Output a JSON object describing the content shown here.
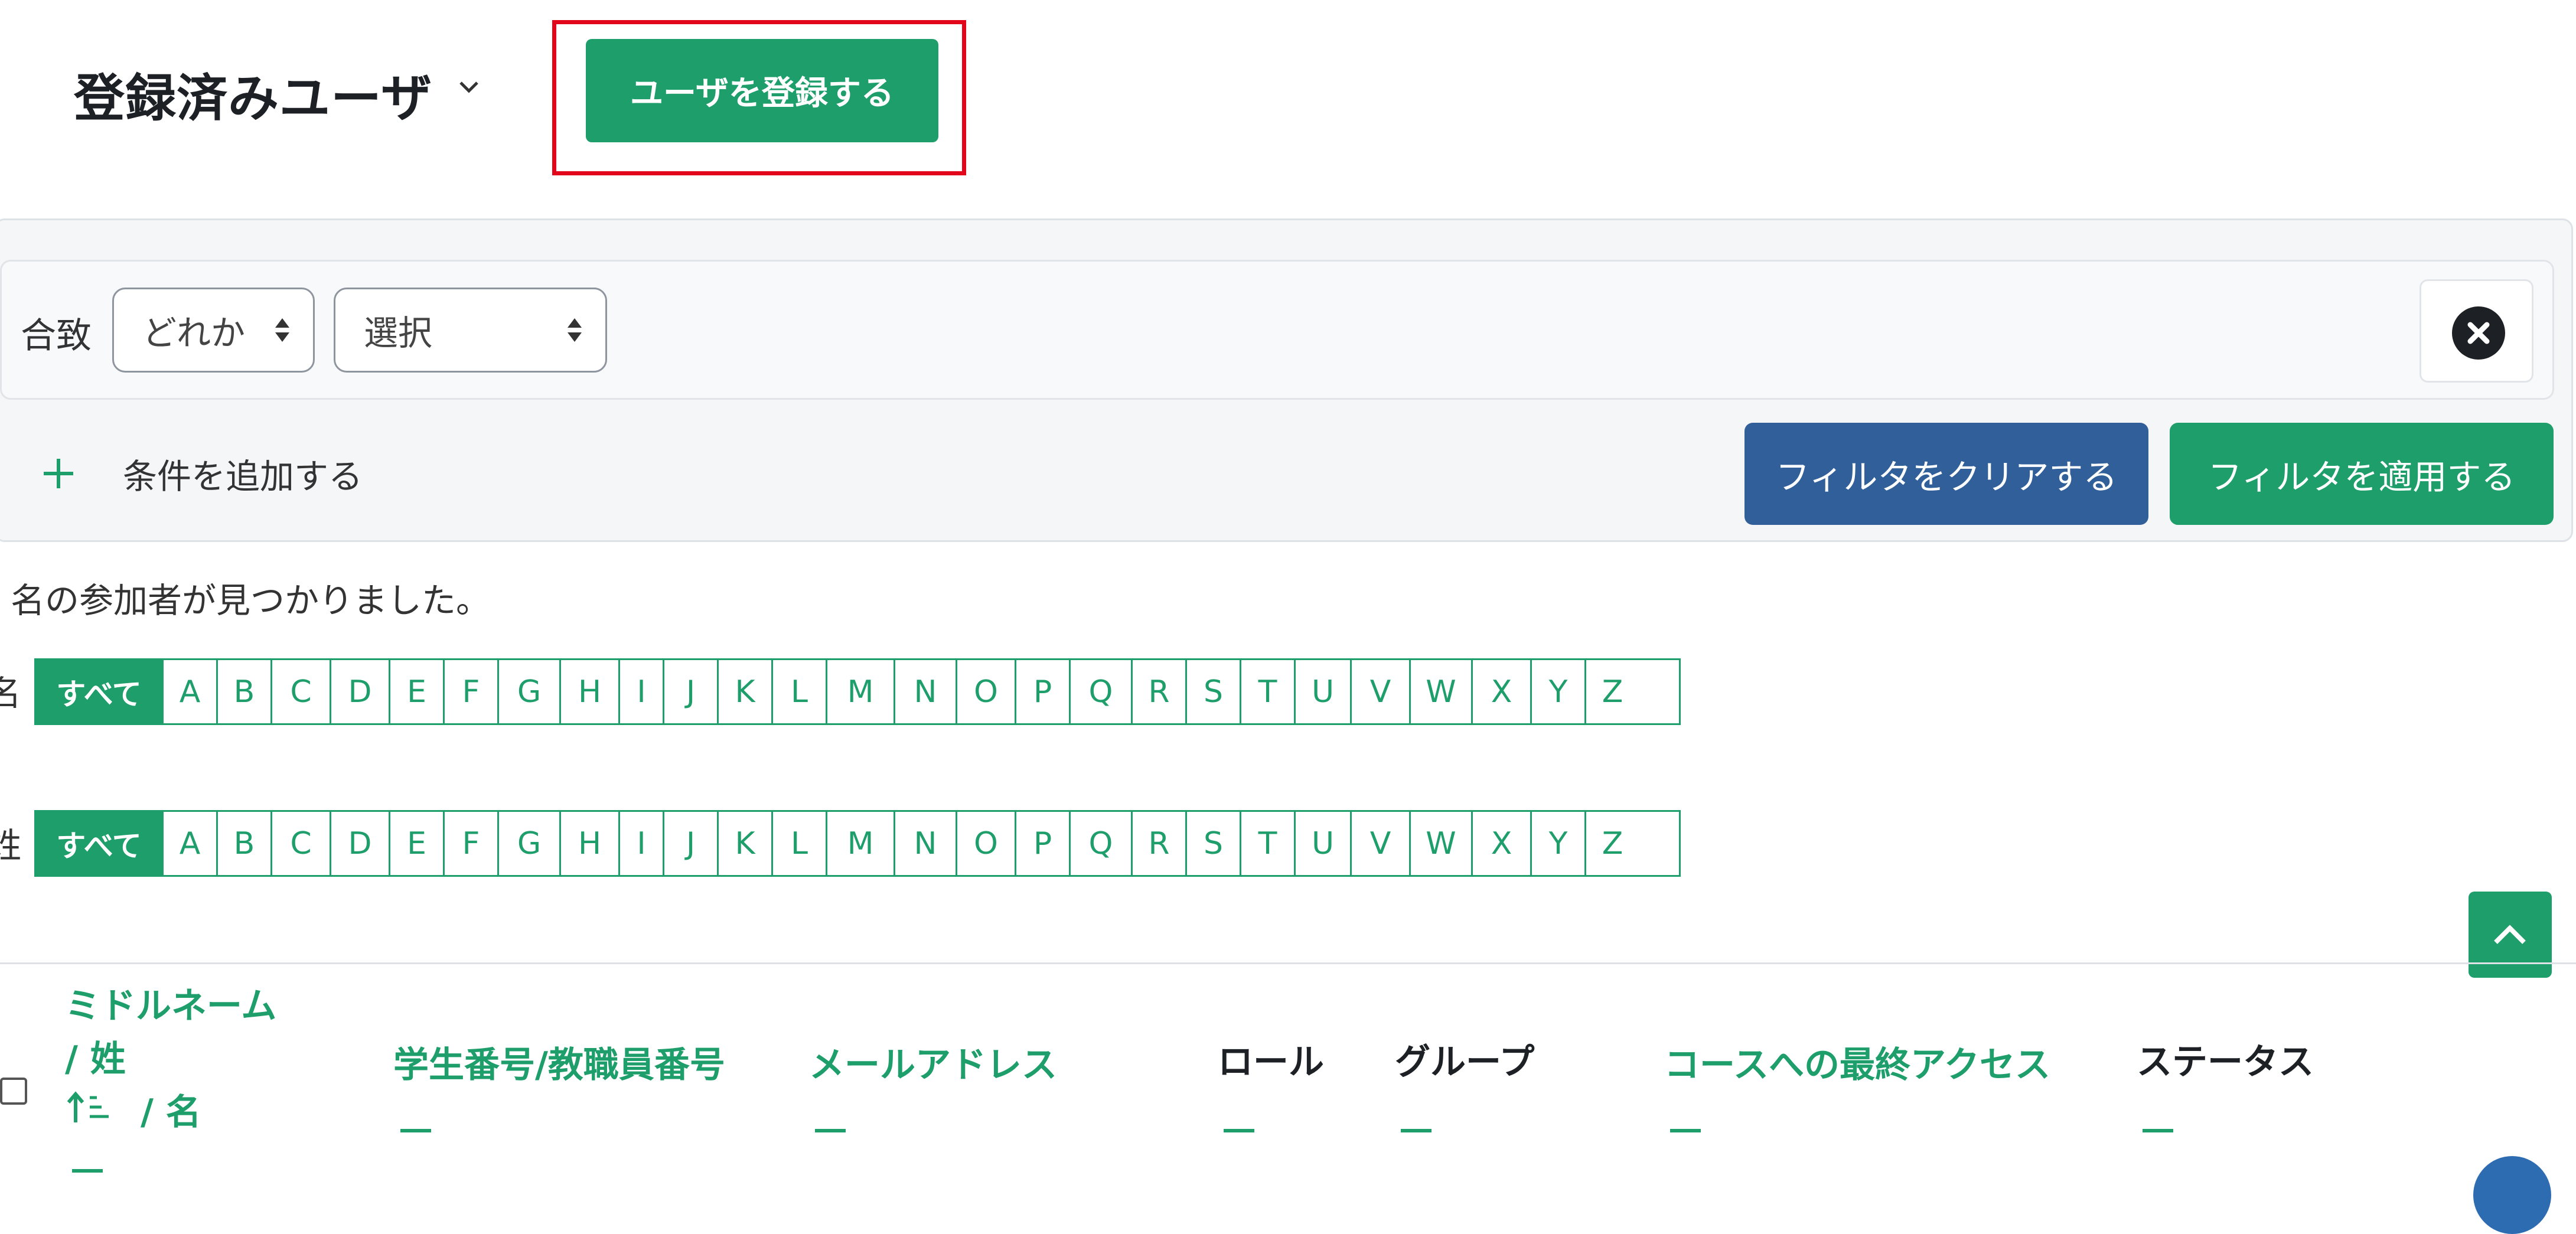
{
  "header": {
    "title": "登録済みユーザ",
    "enrol_button": "ユーザを登録する"
  },
  "filter": {
    "match_label": "合致",
    "match_select": "どれか",
    "type_select": "選択",
    "add_condition": "条件を追加する",
    "clear_button": "フィルタをクリアする",
    "apply_button": "フィルタを適用する"
  },
  "participants_count": "名の参加者が見つかりました。",
  "initials": {
    "first_label": "名",
    "last_label": "姓",
    "all_label": "すべて",
    "letters": [
      "A",
      "B",
      "C",
      "D",
      "E",
      "F",
      "G",
      "H",
      "I",
      "J",
      "K",
      "L",
      "M",
      "N",
      "O",
      "P",
      "Q",
      "R",
      "S",
      "T",
      "U",
      "V",
      "W",
      "X",
      "Y",
      "Z"
    ]
  },
  "table": {
    "col_name_line1": "ミドルネーム",
    "col_name_line2": "/ 姓",
    "col_name_line3": "/ 名",
    "col_id": "学生番号/教職員番号",
    "col_email": "メールアドレス",
    "col_role": "ロール",
    "col_group": "グループ",
    "col_lastaccess": "コースへの最終アクセス",
    "col_status": "ステータス"
  },
  "colors": {
    "primary_green": "#1e9e6a",
    "clear_blue": "#315f99",
    "highlight_red": "#e2061b"
  }
}
